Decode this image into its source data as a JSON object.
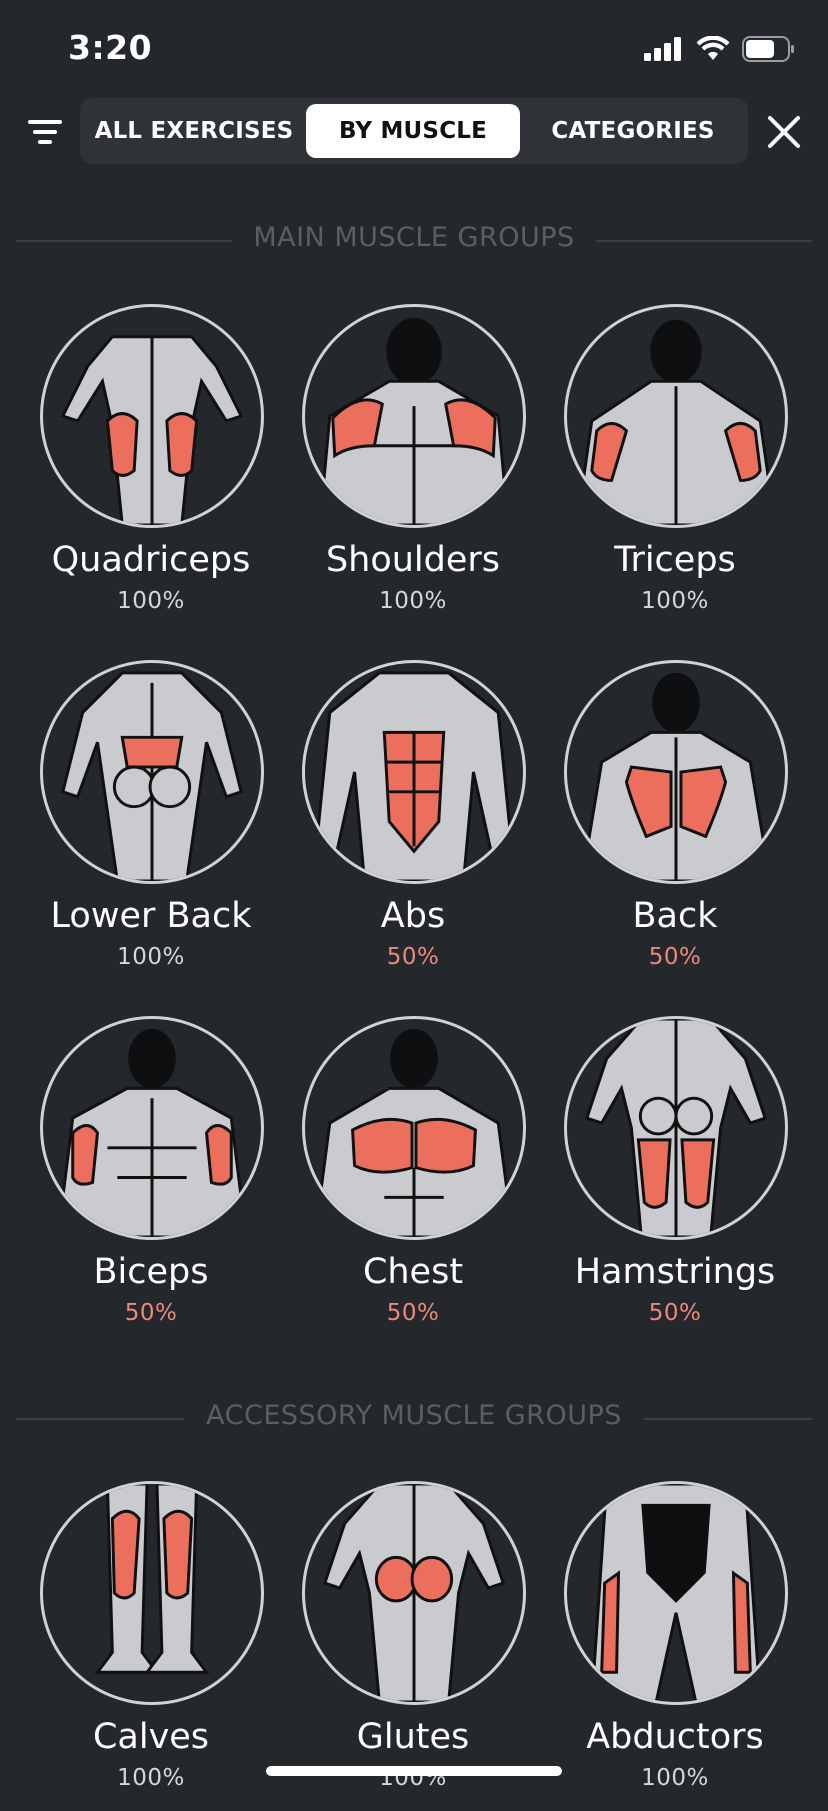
{
  "status": {
    "time": "3:20"
  },
  "tabs": [
    {
      "label": "ALL EXERCISES",
      "active": false
    },
    {
      "label": "BY MUSCLE",
      "active": true
    },
    {
      "label": "CATEGORIES",
      "active": false
    }
  ],
  "sections": {
    "main": "MAIN MUSCLE GROUPS",
    "accessory": "ACCESSORY MUSCLE GROUPS"
  },
  "muscles": [
    {
      "name": "Quadriceps",
      "percent": "100%"
    },
    {
      "name": "Shoulders",
      "percent": "100%"
    },
    {
      "name": "Triceps",
      "percent": "100%"
    },
    {
      "name": "Lower Back",
      "percent": "100%"
    },
    {
      "name": "Abs",
      "percent": "50%"
    },
    {
      "name": "Back",
      "percent": "50%"
    },
    {
      "name": "Biceps",
      "percent": "50%"
    },
    {
      "name": "Chest",
      "percent": "50%"
    },
    {
      "name": "Hamstrings",
      "percent": "50%"
    },
    {
      "name": "Calves",
      "percent": "100%"
    },
    {
      "name": "Glutes",
      "percent": "100%"
    },
    {
      "name": "Abductors",
      "percent": "100%"
    }
  ],
  "colors": {
    "background": "#24272b",
    "highlight": "#ec6f5e",
    "body": "#c9cbce",
    "half_percent": "#e98a7c"
  },
  "icons": {
    "filter": "filter-icon",
    "close": "close-icon",
    "signal": "cellular-signal-icon",
    "wifi": "wifi-icon",
    "battery": "battery-icon"
  }
}
